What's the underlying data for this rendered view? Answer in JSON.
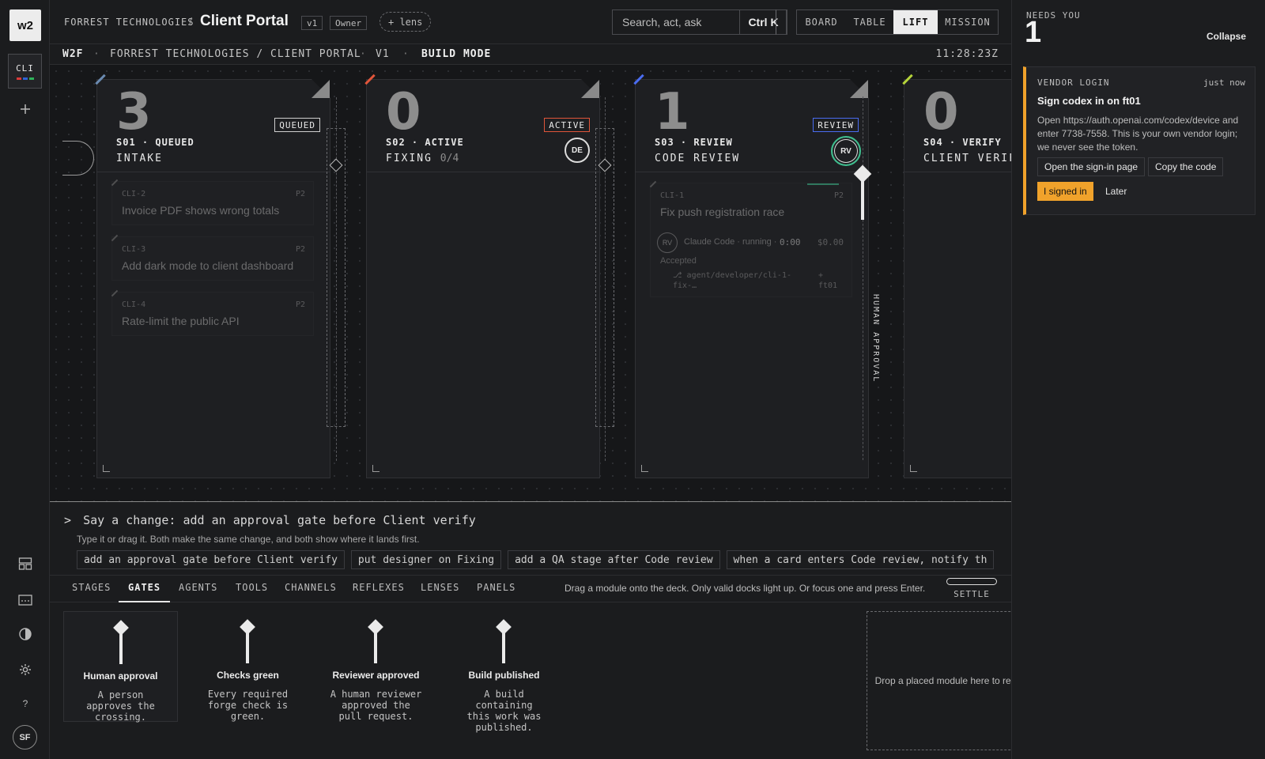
{
  "rail": {
    "logo": "w2",
    "project_code": "CLI",
    "project_colors": [
      "#d93a3a",
      "#2f64d6",
      "#2fb35a"
    ],
    "add_icon": "plus-icon",
    "bottom_icons": [
      "grid-icon",
      "card-icon",
      "contrast-icon",
      "gear-icon",
      "help-icon"
    ],
    "help_glyph": "?",
    "avatar": "SF"
  },
  "header": {
    "org": "FORREST TECHNOLOGIES",
    "separator": "/",
    "title": "Client Portal",
    "version": "v1",
    "role": "Owner",
    "lens_label": "+ lens",
    "search_placeholder": "Search, act, ask",
    "shortcut": "Ctrl K",
    "views": [
      {
        "label": "BOARD",
        "active": false
      },
      {
        "label": "TABLE",
        "active": false
      },
      {
        "label": "LIFT",
        "active": true
      },
      {
        "label": "MISSION",
        "active": false
      }
    ]
  },
  "subbar": {
    "brand": "W2F",
    "path": "FORREST TECHNOLOGIES / CLIENT PORTAL",
    "version": "V1",
    "mode": "BUILD MODE",
    "dot": "·",
    "clock": "11:28:23Z"
  },
  "stages": [
    {
      "count": "3",
      "code": "S01 · QUEUED",
      "name": "INTAKE",
      "sub": "",
      "badge": "QUEUED",
      "badge_color": "#cfcfcf",
      "accent": "#6a8ab0",
      "role": "",
      "cards": [
        {
          "id": "CLI-2",
          "priority": "P2",
          "title": "Invoice PDF shows wrong totals"
        },
        {
          "id": "CLI-3",
          "priority": "P2",
          "title": "Add dark mode to client dashboard"
        },
        {
          "id": "CLI-4",
          "priority": "P2",
          "title": "Rate-limit the public API"
        }
      ]
    },
    {
      "count": "0",
      "code": "S02 · ACTIVE",
      "name": "FIXING",
      "sub": "0/4",
      "badge": "ACTIVE",
      "badge_color": "#e0553a",
      "accent": "#e0553a",
      "role": "DE",
      "cards": []
    },
    {
      "count": "1",
      "code": "S03 · REVIEW",
      "name": "CODE REVIEW",
      "sub": "",
      "badge": "REVIEW",
      "badge_color": "#4a6cf0",
      "accent": "#4a6cf0",
      "role": "RV",
      "cards": [
        {
          "id": "CLI-1",
          "priority": "P2",
          "title": "Fix push registration race",
          "agent_role": "RV",
          "agent": "Claude Code · running ·",
          "elapsed": "0:00",
          "cost": "$0.00",
          "status": "Accepted",
          "branch": "⎇ agent/developer/cli-1-fix-…",
          "host": "+ ft01"
        }
      ]
    },
    {
      "count": "0",
      "code": "S04 · VERIFY",
      "name": "CLIENT VERIFY",
      "sub": "",
      "badge": "",
      "badge_color": "#b5d43a",
      "accent": "#b5d43a",
      "role": "",
      "cards": []
    }
  ],
  "gate_label": "HUMAN APPROVAL",
  "command": {
    "prompt": ">",
    "text": "Say a change: add an approval gate before Client verify",
    "help": "Type it or drag it. Both make the same change, and both show where it lands first.",
    "suggestions": [
      "add an approval gate before Client verify",
      "put designer on Fixing",
      "add a QA stage after Code review",
      "when a card enters Code review, notify th"
    ]
  },
  "tabs": {
    "items": [
      {
        "label": "STAGES",
        "active": false
      },
      {
        "label": "GATES",
        "active": true
      },
      {
        "label": "AGENTS",
        "active": false
      },
      {
        "label": "TOOLS",
        "active": false
      },
      {
        "label": "CHANNELS",
        "active": false
      },
      {
        "label": "REFLEXES",
        "active": false
      },
      {
        "label": "LENSES",
        "active": false
      },
      {
        "label": "PANELS",
        "active": false
      }
    ],
    "hint": "Drag a module onto the deck. Only valid docks light up. Or focus one and press Enter.",
    "settle": "SETTLE"
  },
  "modules": [
    {
      "title": "Human approval",
      "desc": "A person approves the crossing."
    },
    {
      "title": "Checks green",
      "desc": "Every required forge check is green."
    },
    {
      "title": "Reviewer approved",
      "desc": "A human reviewer approved the pull request."
    },
    {
      "title": "Build published",
      "desc": "A build containing this work was published."
    }
  ],
  "dropzone": "Drop a placed module here to remove it",
  "right": {
    "needs_label": "NEEDS YOU",
    "needs_count": "1",
    "collapse": "Collapse",
    "notice": {
      "kind": "VENDOR LOGIN",
      "when": "just now",
      "title": "Sign codex in on ft01",
      "body": "Open https://auth.openai.com/codex/device and enter 7738-7558. This is your own vendor login; we never see the token.",
      "btn_open": "Open the sign-in page",
      "btn_copy": "Copy the code",
      "btn_done": "I signed in",
      "btn_later": "Later"
    }
  }
}
